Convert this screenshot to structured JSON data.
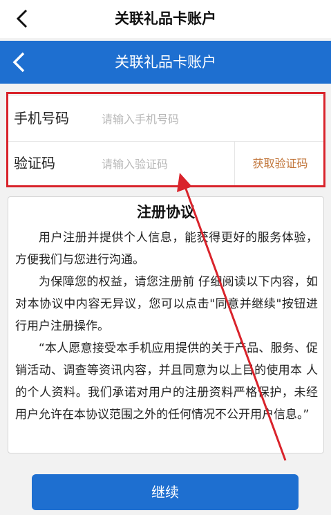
{
  "top_bar": {
    "title": "关联礼品卡账户"
  },
  "nav_bar": {
    "title": "关联礼品卡账户"
  },
  "form": {
    "phone_label": "手机号码",
    "phone_placeholder": "请输入手机号码",
    "code_label": "验证码",
    "code_placeholder": "请输入验证码",
    "get_code_label": "获取验证码"
  },
  "agreement": {
    "title": "注册协议",
    "paragraphs": [
      "用户注册并提供个人信息，能获得更好的服务体验，方便我们与您进行沟通。",
      "为保障您的权益，请您注册前 仔细阅读以下内容，如对本协议中内容无异议，您可以点击\"同意并继续\"按钮进行用户注册操作。",
      "“本人愿意接受本手机应用提供的关于产品、服务、促销活动、调查等资讯内容，并且同意为以上目的使用本 人的个人资料。我们承诺对用户的注册资料严格保护，未经用户允许在本协议范围之外的任何情况不公开用户信息。”"
    ]
  },
  "continue_label": "继续",
  "colors": {
    "brand_blue": "#1e6fd0",
    "highlight_red": "#d9232b",
    "get_code_orange": "#c2773d"
  }
}
